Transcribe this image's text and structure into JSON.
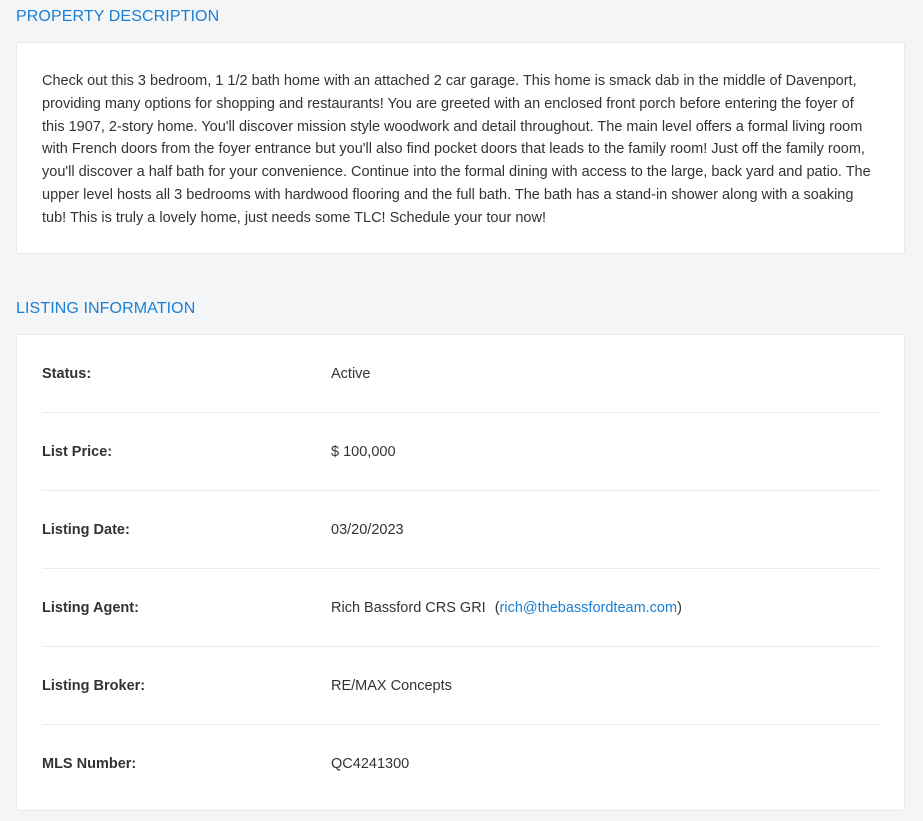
{
  "property_description": {
    "title": "PROPERTY DESCRIPTION",
    "text": "Check out this 3 bedroom, 1 1/2 bath home with an attached 2 car garage. This home is smack dab in the middle of Davenport, providing many options for shopping and restaurants! You are greeted with an enclosed front porch before entering the foyer of this 1907, 2-story home. You'll discover mission style woodwork and detail throughout. The main level offers a formal living room with French doors from the foyer entrance but you'll also find pocket doors that leads to the family room! Just off the family room, you'll discover a half bath for your convenience. Continue into the formal dining with access to the large, back yard and patio. The upper level hosts all 3 bedrooms with hardwood flooring and the full bath. The bath has a stand-in shower along with a soaking tub! This is truly a lovely home, just needs some TLC! Schedule your tour now!"
  },
  "listing_information": {
    "title": "LISTING INFORMATION",
    "status": {
      "label": "Status:",
      "value": "Active"
    },
    "list_price": {
      "label": "List Price:",
      "value": "$ 100,000"
    },
    "listing_date": {
      "label": "Listing Date:",
      "value": "03/20/2023"
    },
    "listing_agent": {
      "label": "Listing Agent:",
      "name": "Rich Bassford CRS GRI",
      "email": "rich@thebassfordteam.com"
    },
    "listing_broker": {
      "label": "Listing Broker:",
      "value": "RE/MAX Concepts"
    },
    "mls_number": {
      "label": "MLS Number:",
      "value": "QC4241300"
    }
  },
  "colors": {
    "accent": "#1a7fd4",
    "text": "#333333",
    "background": "#f4f5f7",
    "card": "#ffffff"
  }
}
